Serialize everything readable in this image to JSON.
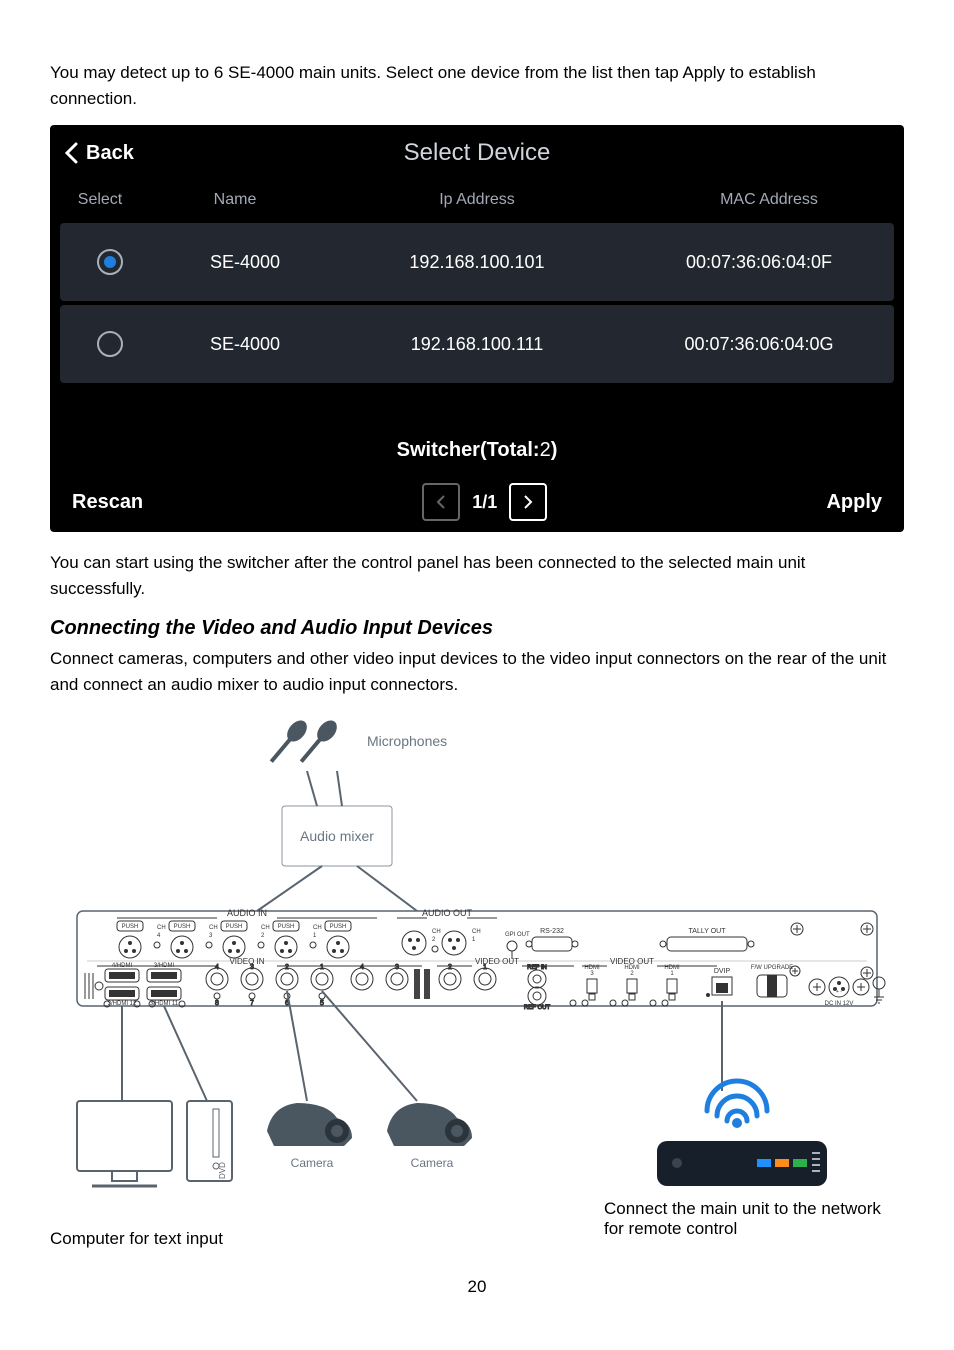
{
  "intro_text": "You may detect up to 6 SE-4000 main units. Select one device from the list then tap Apply to establish connection.",
  "panel": {
    "back": "Back",
    "title": "Select Device",
    "cols": {
      "select": "Select",
      "name": "Name",
      "ip": "Ip Address",
      "mac": "MAC Address"
    },
    "rows": [
      {
        "selected": true,
        "name": "SE-4000",
        "ip": "192.168.100.101",
        "mac": "00:07:36:06:04:0F"
      },
      {
        "selected": false,
        "name": "SE-4000",
        "ip": "192.168.100.111",
        "mac": "00:07:36:06:04:0G"
      }
    ],
    "total_label": "Switcher(Total:",
    "total_value": "2",
    "total_close": ")",
    "rescan": "Rescan",
    "page": "1/1",
    "apply": "Apply"
  },
  "after_panel": "You can start using the switcher after the control panel has been connected to the selected main unit successfully.",
  "section_title": "Connecting the Video and Audio Input Devices",
  "section_body": "Connect cameras, computers and other video input devices to the video input connectors on the rear of the unit and connect an audio mixer to audio input connectors.",
  "diagram": {
    "mics": "Microphones",
    "mixer": "Audio mixer",
    "camera": "Camera",
    "audio_in": "AUDIO IN",
    "audio_out": "AUDIO OUT",
    "video_in": "VIDEO IN",
    "video_out": "VIDEO OUT",
    "tally": "TALLY OUT",
    "rs232": "RS-232",
    "gpi": "GPI OUT",
    "refin": "REF IN",
    "refout": "REF OUT",
    "dcin": "DC IN 12V",
    "dvip": "DVIP",
    "fw": "F/W UPGRADE",
    "push": "PUSH",
    "ch": "CH",
    "hdmi": "HDMI"
  },
  "note_left": "Computer for text input",
  "note_right": "Connect the main unit to the network for remote control",
  "page_number": "20"
}
